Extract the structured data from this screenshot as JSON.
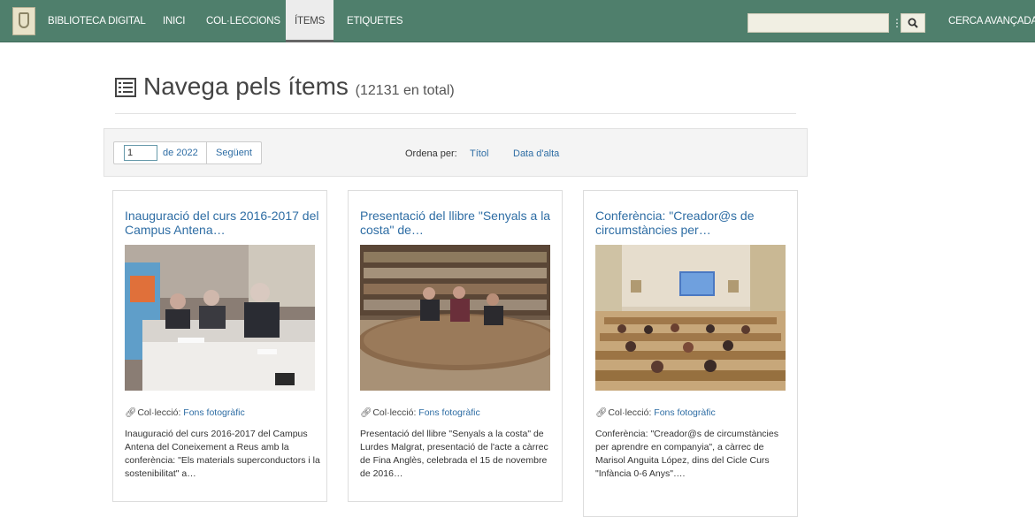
{
  "navbar": {
    "brand": "BIBLIOTECA DIGITAL",
    "links": [
      "INICI",
      "COL·LECCIONS",
      "ÍTEMS",
      "ETIQUETES"
    ],
    "active_link": "ÍTEMS",
    "search": {
      "value": "",
      "placeholder": ""
    },
    "advanced_search": "CERCA AVANÇADA",
    "colors": {
      "bar": "#4f7f6c",
      "active": "#ececec"
    }
  },
  "header": {
    "title": "Navega pels ítems",
    "count": "(12131 en total)"
  },
  "pager": {
    "page_value": "1",
    "of_label": "de 2022",
    "next_label": "Següent"
  },
  "sort": {
    "label": "Ordena per:",
    "options": [
      "Títol",
      "Data d'alta"
    ]
  },
  "items": [
    {
      "title": "Inauguració del curs 2016-2017 del Campus Antena…",
      "collection_label": "Col·lecció:",
      "collection_name": "Fons fotogràfic",
      "description": "Inauguració del curs 2016-2017 del Campus Antena del Coneixement a Reus amb la conferència: \"Els materials superconductors i la sostenibilitat\" a…"
    },
    {
      "title": "Presentació del llibre \"Senyals a la costa\" de…",
      "collection_label": "Col·lecció:",
      "collection_name": "Fons fotogràfic",
      "description": "Presentació del llibre \"Senyals a la costa\" de Lurdes Malgrat, presentació de l'acte a càrrec de Fina Anglès, celebrada el 15 de novembre de 2016…"
    },
    {
      "title": "Conferència: \"Creador@s de circumstàncies per…",
      "collection_label": "Col·lecció:",
      "collection_name": "Fons fotogràfic",
      "description": "Conferència: \"Creador@s de circumstàncies per aprendre en companyia\", a càrrec de Marisol Anguita López, dins del Cicle Curs \"Infància 0-6 Anys\"…."
    }
  ],
  "link_color": "#2e6da4"
}
